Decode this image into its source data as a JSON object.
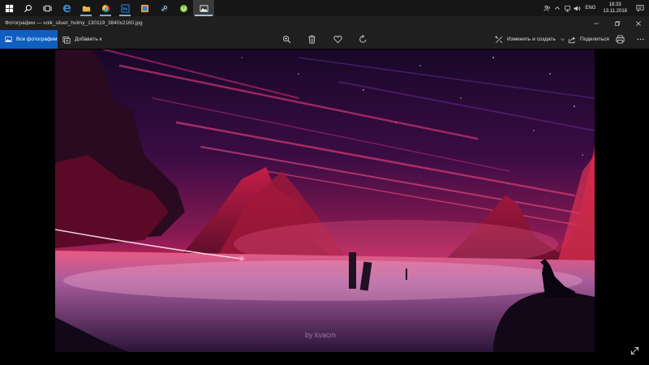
{
  "taskbar": {
    "apps": [
      {
        "name": "start"
      },
      {
        "name": "search"
      },
      {
        "name": "task-view"
      },
      {
        "name": "edge"
      },
      {
        "name": "file-explorer"
      },
      {
        "name": "chrome"
      },
      {
        "name": "photoshop"
      },
      {
        "name": "app-green"
      },
      {
        "name": "steam"
      },
      {
        "name": "utorrent"
      },
      {
        "name": "photos"
      }
    ],
    "tray": {
      "language": "ENG",
      "time": "18:33",
      "date": "13.11.2018"
    }
  },
  "window": {
    "title": "Фотографии — volk_siluet_holmy_130119_3840x2160.jpg"
  },
  "toolbar": {
    "all_photos_label": "Все фотографии",
    "add_to_label": "Добавить к",
    "edit_create_label": "Изменить и создать",
    "share_label": "Поделиться"
  },
  "photo": {
    "watermark": "by kvacm"
  }
}
